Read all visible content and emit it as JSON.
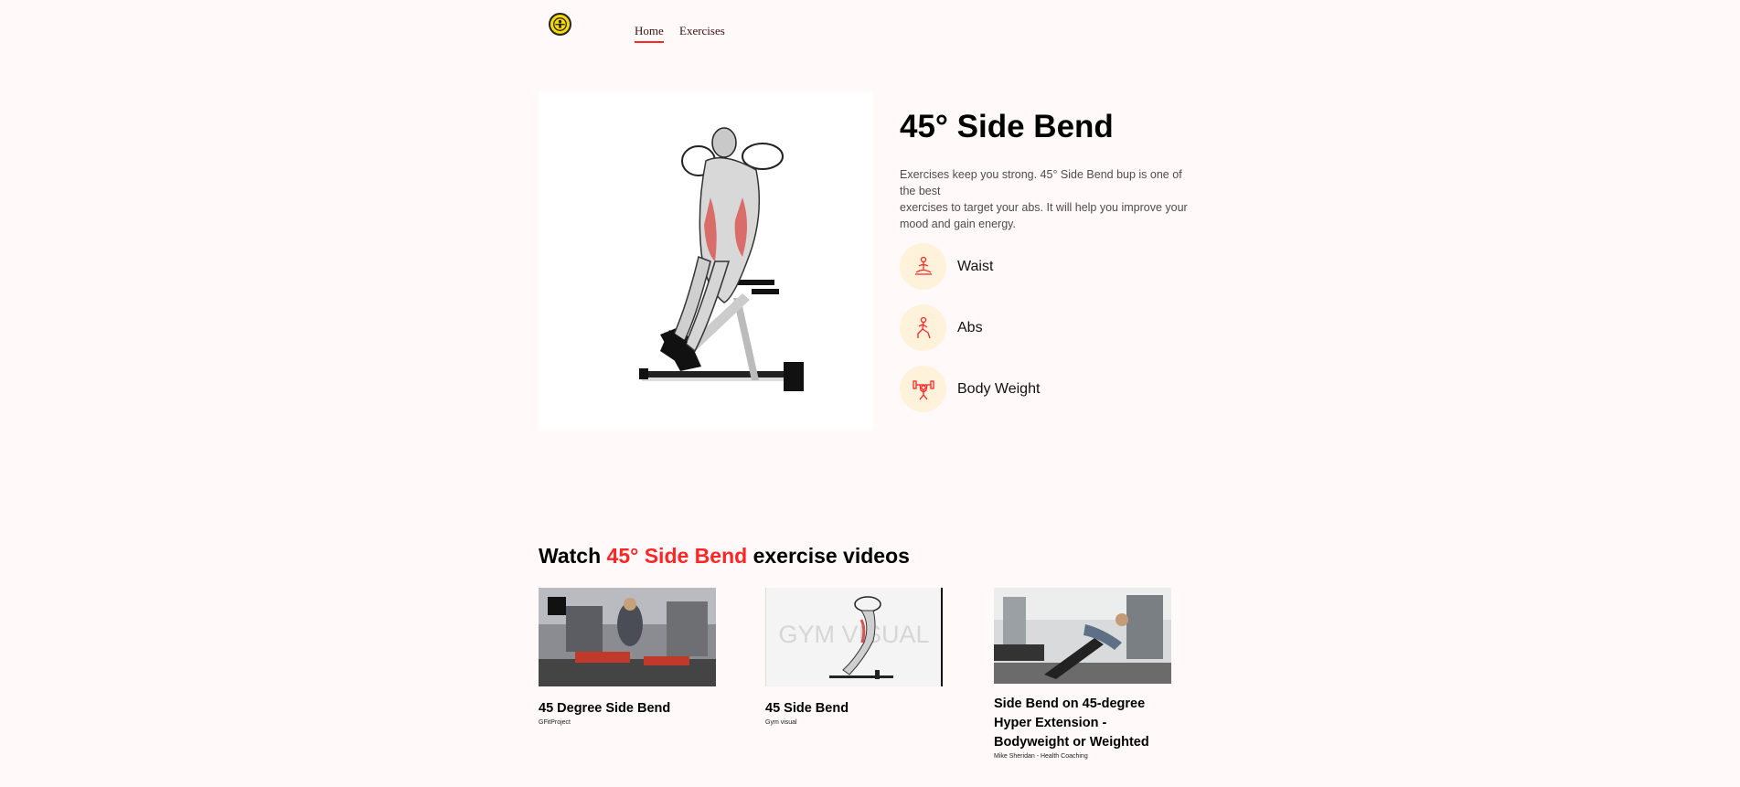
{
  "nav": {
    "logo": "gold-gym-logo",
    "links": [
      {
        "label": "Home",
        "active": true
      },
      {
        "label": "Exercises",
        "active": false
      }
    ]
  },
  "exercise": {
    "name": "45° Side Bend",
    "description_line1": "Exercises keep you strong. 45° Side Bend bup is one of the best",
    "description_line2": "exercises to target your abs. It will help you improve your mood and gain energy.",
    "attributes": [
      {
        "label": "Waist",
        "icon": "meditation-icon"
      },
      {
        "label": "Abs",
        "icon": "lunge-icon"
      },
      {
        "label": "Body Weight",
        "icon": "weightlifter-icon"
      }
    ]
  },
  "videos_section": {
    "prefix": "Watch",
    "exercise_name": "45° Side Bend",
    "suffix": "exercise videos",
    "accent_color": "#ff2625"
  },
  "videos": [
    {
      "title": "45 Degree Side Bend",
      "channel": "GFitProject"
    },
    {
      "title": "45 Side Bend",
      "channel": "Gym visual",
      "thumb_text": "GYM VISUAL"
    },
    {
      "title": "Side Bend on 45-degree Hyper Extension - Bodyweight or Weighted",
      "channel": "Mike Sheridan - Health Coaching"
    }
  ]
}
